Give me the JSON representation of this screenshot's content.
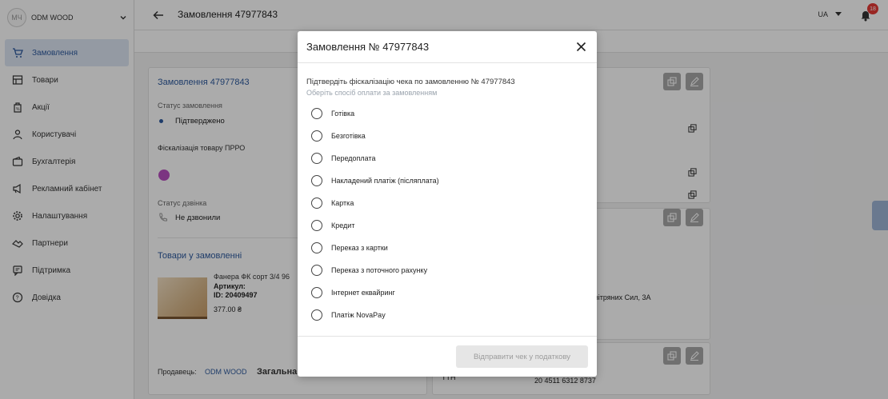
{
  "sidebar": {
    "avatar_initials": "МЧ",
    "company": "ODM WOOD",
    "items": [
      {
        "label": "Замовлення",
        "icon": "cart-icon",
        "active": true
      },
      {
        "label": "Товари",
        "icon": "goods-icon",
        "active": false
      },
      {
        "label": "Акції",
        "icon": "promo-icon",
        "active": false
      },
      {
        "label": "Користувачі",
        "icon": "users-icon",
        "active": false
      },
      {
        "label": "Бухгалтерія",
        "icon": "wallet-icon",
        "active": false
      },
      {
        "label": "Рекламний кабінет",
        "icon": "megaphone-icon",
        "active": false
      },
      {
        "label": "Налаштування",
        "icon": "gear-icon",
        "active": false
      },
      {
        "label": "Партнери",
        "icon": "handshake-icon",
        "active": false
      },
      {
        "label": "Підтримка",
        "icon": "support-icon",
        "active": false
      },
      {
        "label": "Довідка",
        "icon": "help-icon",
        "active": false
      }
    ]
  },
  "topbar": {
    "title": "Замовлення 47977843",
    "language": "UA",
    "notifications_count": "18"
  },
  "order_card": {
    "title": "Замовлення 47977843",
    "status_label": "Статус замовлення",
    "status_value": "Підтверджено",
    "prro_label": "Фіскалізація товару ПРРО",
    "call_status_label": "Статус дзвінка",
    "call_status_value": "Не дзвонили",
    "products_title": "Товари у замовленні",
    "product_name": "Фанера ФК сорт 3/4 96",
    "product_article": "Артикул:",
    "product_id": "ID: 20409497",
    "product_price": "377.00 ₴",
    "seller_label": "Продавець:",
    "seller_name": "ODM WOOD",
    "total_label": "Загальна"
  },
  "right_cards": {
    "partial_digit": "9",
    "address_fragment": "вітряних Сил, 3А",
    "ttn_label": "ТТН",
    "ttn_value": "20 4511 6312 8737"
  },
  "modal": {
    "title": "Замовлення № 47977843",
    "confirm_text": "Підтвердіть фіскалізацію чека по замовленню № 47977843",
    "hint_text": "Оберіть спосіб оплати за замовленням",
    "options": [
      "Готівка",
      "Безготівка",
      "Передоплата",
      "Накладений платіж (післяплата)",
      "Картка",
      "Кредит",
      "Переказ з картки",
      "Переказ з поточного рахунку",
      "Інтернет еквайринг",
      "Платіж NovaPay"
    ],
    "submit_label": "Відправити чек у податкову"
  }
}
